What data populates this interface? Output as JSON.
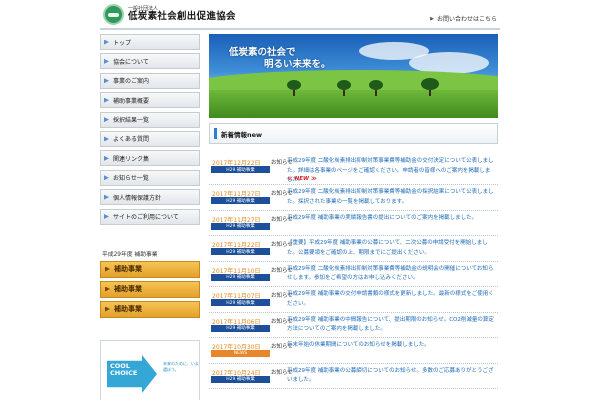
{
  "header": {
    "logo_sub": "一般社団法人",
    "logo_main": "低炭素社会創出促進協会",
    "contact": "お問い合わせはこちら"
  },
  "sidebar": {
    "items": [
      {
        "label": "トップ"
      },
      {
        "label": "協会について"
      },
      {
        "label": "事業のご案内"
      },
      {
        "label": "補助事業概要"
      },
      {
        "label": "採択結果一覧"
      },
      {
        "label": "よくある質問"
      },
      {
        "label": "関連リンク集"
      },
      {
        "label": "お知らせ一覧"
      },
      {
        "label": "個人情報保護方針"
      },
      {
        "label": "サイトのご利用について"
      }
    ],
    "section_heading": "平成29年度 補助事業",
    "gold_buttons": [
      {
        "label": "補助事業"
      },
      {
        "label": "補助事業"
      },
      {
        "label": "補助事業"
      }
    ],
    "banner": {
      "line1": "COOL",
      "line2": "CHOICE",
      "caption": "未来のために、いま選ぼう。"
    }
  },
  "hero": {
    "line1": "低炭素の社会で",
    "line2": "明るい未来を。"
  },
  "news": {
    "title": "新着情報new",
    "new_badge": "≪ NEW ≫",
    "items": [
      {
        "date": "2017年12月22日",
        "tag": "H29 補助事業",
        "type": "お知らせ",
        "text": "平成29年度 二酸化炭素排出抑制対策事業費等補助金の交付決定について公表しました。詳細は各事業のページをご確認ください。申請者の皆様へのご案内を掲載しました。",
        "is_new": true,
        "tag_style": "h29"
      },
      {
        "date": "2017年11月27日",
        "tag": "H29 補助事業",
        "type": "お知らせ",
        "text": "平成29年度 二酸化炭素排出抑制対策事業費等補助金の採択結果について公表しました。採択された事業の一覧を掲載しております。",
        "is_new": false,
        "tag_style": "h29"
      },
      {
        "date": "2017年11月27日",
        "tag": "H29 補助事業",
        "type": "お知らせ",
        "text": "平成29年度 補助事業の実績報告書の提出についてのご案内を掲載しました。",
        "is_new": false,
        "tag_style": "h29"
      },
      {
        "date": "2017年11月22日",
        "tag": "H29 補助事業",
        "type": "お知らせ",
        "text": "【重要】平成29年度 補助事業の公募について、二次公募の申請受付を開始しました。公募要領をご確認の上、期限までにご提出ください。",
        "is_new": false,
        "tag_style": "h29"
      },
      {
        "date": "2017年11月10日",
        "tag": "H29 補助事業",
        "type": "お知らせ",
        "text": "平成29年度 二酸化炭素排出抑制対策事業費等補助金の説明会の開催についてお知らせします。参加をご希望の方はお申し込みください。",
        "is_new": false,
        "tag_style": "h29"
      },
      {
        "date": "2017年11月07日",
        "tag": "H29 補助事業",
        "type": "お知らせ",
        "text": "平成29年度 補助事業の交付申請書類の様式を更新しました。最新の様式をご使用ください。",
        "is_new": false,
        "tag_style": "h29"
      },
      {
        "date": "2017年11月06日",
        "tag": "H29 補助事業",
        "type": "お知らせ",
        "text": "平成29年度 補助事業の中間報告について、提出期限のお知らせ。CO2削減量の算定方法についてのご案内を掲載しました。",
        "is_new": false,
        "tag_style": "h29"
      },
      {
        "date": "2017年10月30日",
        "tag": "NEWS",
        "type": "お知らせ",
        "text": "年末年始の休業期間についてのお知らせを掲載しました。",
        "is_new": false,
        "tag_style": "news"
      },
      {
        "date": "2017年10月24日",
        "tag": "H29 補助事業",
        "type": "お知らせ",
        "text": "平成29年度 補助事業の公募締切についてのお知らせ。多数のご応募ありがとうございました。",
        "is_new": false,
        "tag_style": "h29"
      }
    ]
  }
}
